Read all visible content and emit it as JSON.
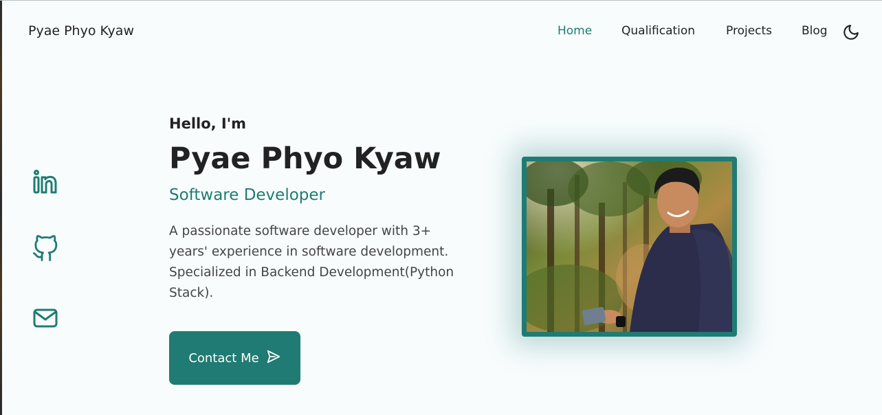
{
  "header": {
    "logo": "Pyae Phyo Kyaw",
    "nav": [
      {
        "label": "Home",
        "active": true
      },
      {
        "label": "Qualification",
        "active": false
      },
      {
        "label": "Projects",
        "active": false
      },
      {
        "label": "Blog",
        "active": false
      }
    ],
    "theme_toggle_icon": "moon-icon"
  },
  "social": [
    {
      "icon": "linkedin-icon"
    },
    {
      "icon": "github-icon"
    },
    {
      "icon": "mail-icon"
    }
  ],
  "hero": {
    "greeting": "Hello, I'm",
    "name": "Pyae Phyo Kyaw",
    "role": "Software Developer",
    "description": "A passionate software developer with 3+ years' experience in software development. Specialized in Backend Development(Python Stack).",
    "contact_label": "Contact Me",
    "contact_icon": "send-icon"
  },
  "colors": {
    "accent": "#1f7b73",
    "background": "#f8fcfd",
    "text": "#222222"
  }
}
